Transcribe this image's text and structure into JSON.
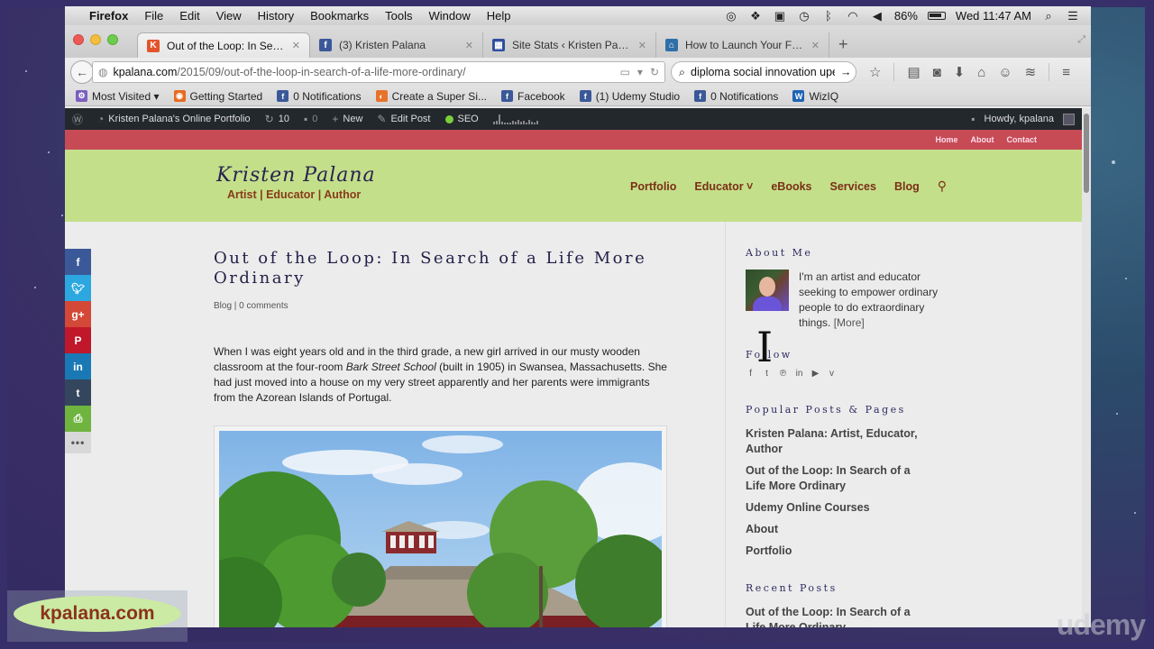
{
  "menubar": {
    "app": "Firefox",
    "items": [
      "File",
      "Edit",
      "View",
      "History",
      "Bookmarks",
      "Tools",
      "Window",
      "Help"
    ],
    "battery": "86%",
    "clock": "Wed 11:47 AM"
  },
  "tabs": [
    {
      "title": "Out of the Loop: In Search...",
      "favicon": "K",
      "favicon_color": "#e2542a",
      "active": true
    },
    {
      "title": "(3) Kristen Palana",
      "favicon": "f",
      "favicon_color": "#3b5998",
      "active": false
    },
    {
      "title": "Site Stats ‹ Kristen Palana'...",
      "favicon": "▦",
      "favicon_color": "#2f4f9e",
      "active": false
    },
    {
      "title": "How to Launch Your First ...",
      "favicon": "⌂",
      "favicon_color": "#2f6fa8",
      "active": false
    }
  ],
  "navbar": {
    "url_domain": "kpalana.com",
    "url_path": "/2015/09/out-of-the-loop-in-search-of-a-life-more-ordinary/",
    "search_value": "diploma social innovation upea"
  },
  "bookmarks": [
    {
      "label": "Most Visited ▾",
      "icon": "⚙",
      "color": "#7a5fc0"
    },
    {
      "label": "Getting Started",
      "icon": "◉",
      "color": "#e76b1f"
    },
    {
      "label": "0 Notifications",
      "icon": "f",
      "color": "#3b5998"
    },
    {
      "label": "Create a Super Si...",
      "icon": "◐",
      "color": "#e8722a"
    },
    {
      "label": "Facebook",
      "icon": "f",
      "color": "#3b5998"
    },
    {
      "label": "(1) Udemy Studio",
      "icon": "f",
      "color": "#3b5998"
    },
    {
      "label": "0 Notifications",
      "icon": "f",
      "color": "#3b5998"
    },
    {
      "label": "WizIQ",
      "icon": "W",
      "color": "#1e64b4"
    }
  ],
  "wpbar": {
    "site": "Kristen Palana's Online Portfolio",
    "updates": "10",
    "comments": "0",
    "new": "New",
    "edit": "Edit Post",
    "seo": "SEO",
    "howdy": "Howdy, kpalana"
  },
  "topnav": [
    "Home",
    "About",
    "Contact"
  ],
  "header": {
    "name": "Kristen Palana",
    "tagline": "Artist | Educator | Author",
    "nav": [
      "Portfolio",
      "Educator ˅",
      "eBooks",
      "Services",
      "Blog"
    ]
  },
  "post": {
    "title": "Out of the Loop: In Search of a Life More Ordinary",
    "category": "Blog",
    "comments": "0 comments",
    "body_before": "When I was eight years old and in the third grade, a new girl arrived in our musty wooden classroom at the four-room ",
    "body_em": "Bark Street School",
    "body_after": " (built in 1905) in Swansea, Massachusetts. She had just moved into a house on my very street apparently and her parents were immigrants from the Azorean Islands of Portugal."
  },
  "sidebar": {
    "about_title": "About Me",
    "about_text": "I'm an artist and educator seeking to empower ordinary people to do extraordinary things. ",
    "about_more": "[More]",
    "follow_title": "Follow",
    "social": [
      "facebook",
      "twitter",
      "pinterest",
      "linkedin",
      "youtube",
      "vimeo"
    ],
    "popular_title": "Popular Posts & Pages",
    "popular": [
      "Kristen Palana: Artist, Educator, Author",
      "Out of the Loop: In Search of a Life More Ordinary",
      "Udemy Online Courses",
      "About",
      "Portfolio"
    ],
    "recent_title": "Recent Posts",
    "recent": [
      "Out of the Loop: In Search of a Life More Ordinary"
    ]
  },
  "share": [
    {
      "name": "facebook",
      "glyph": "f",
      "color": "#3b5998"
    },
    {
      "name": "twitter",
      "glyph": "🐦︎",
      "color": "#2ca7e0"
    },
    {
      "name": "google-plus",
      "glyph": "g+",
      "color": "#d34836"
    },
    {
      "name": "pinterest",
      "glyph": "P",
      "color": "#c0172a"
    },
    {
      "name": "linkedin",
      "glyph": "in",
      "color": "#1a78b5"
    },
    {
      "name": "tumblr",
      "glyph": "t",
      "color": "#34465d"
    },
    {
      "name": "print",
      "glyph": "⎙",
      "color": "#6eb43f"
    }
  ],
  "share_more": "•••",
  "watermark": "kpalana.com",
  "udemy": "udemy"
}
